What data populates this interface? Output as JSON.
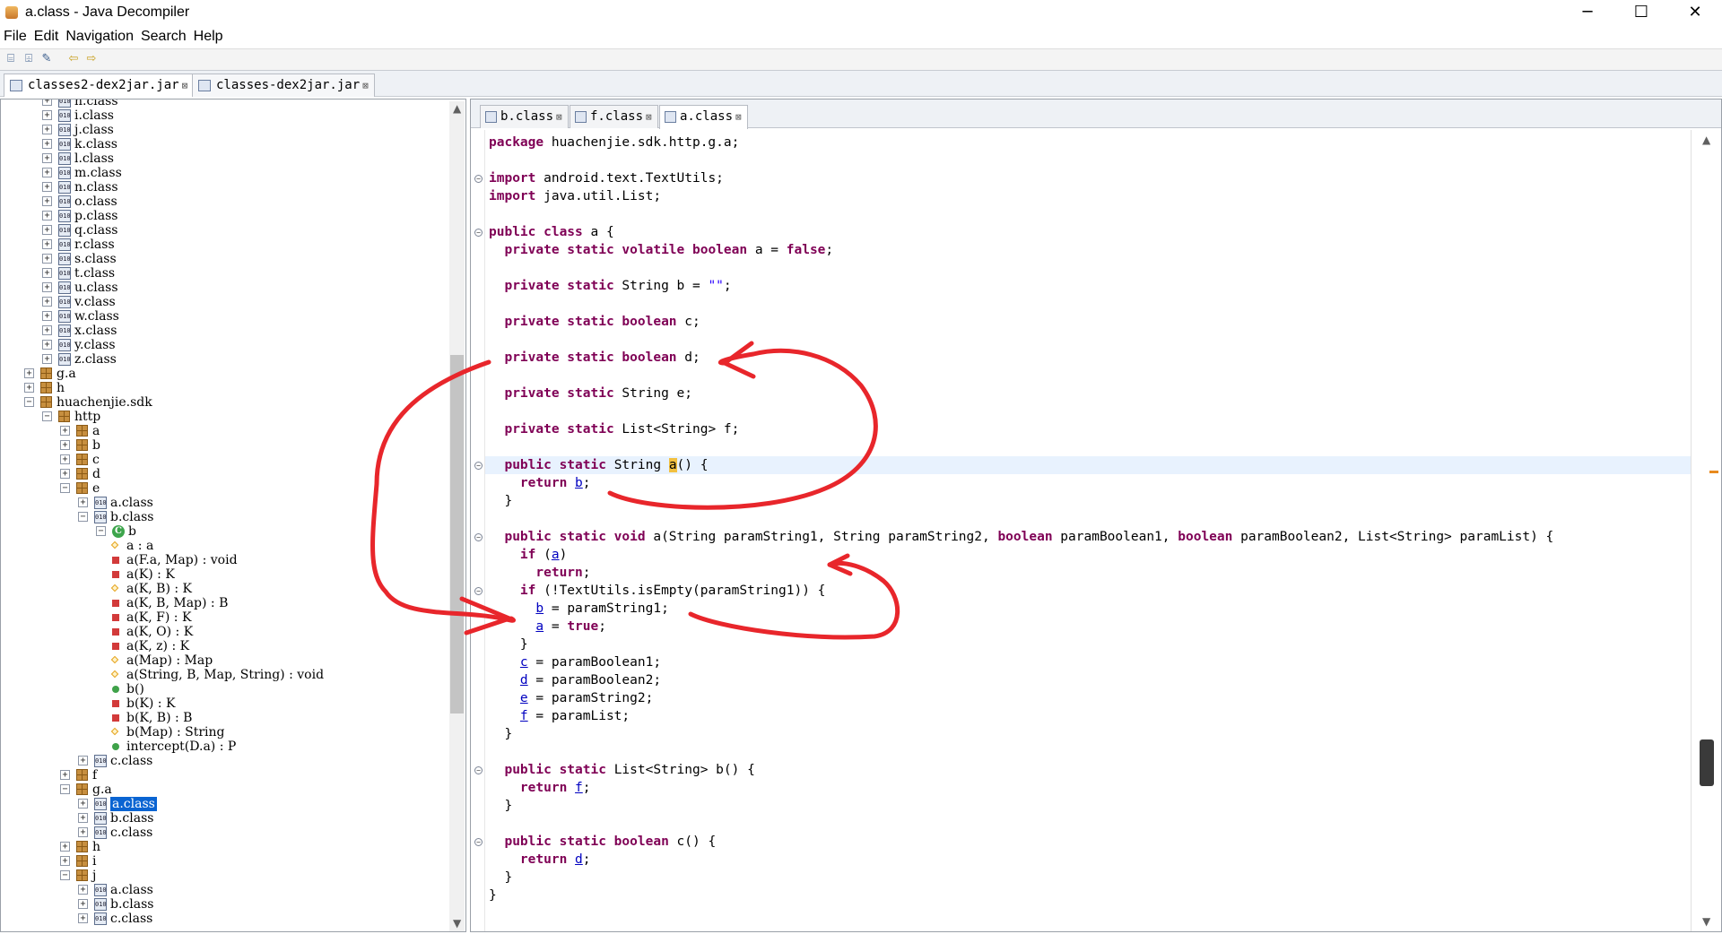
{
  "window": {
    "title": "a.class - Java Decompiler",
    "minimize": "─",
    "maximize": "☐",
    "close": "✕"
  },
  "menu": [
    "File",
    "Edit",
    "Navigation",
    "Search",
    "Help"
  ],
  "toolbar": {
    "icons": [
      "open-folder-icon",
      "open-file-icon",
      "pin-icon",
      "back-arrow-icon",
      "forward-arrow-icon"
    ],
    "glyphs": [
      "⌸",
      "⌹",
      "✎",
      "⇦",
      "⇨"
    ]
  },
  "jar_tabs": [
    {
      "label": "classes2-dex2jar.jar",
      "close": "⊠",
      "active": true
    },
    {
      "label": "classes-dex2jar.jar",
      "close": "⊠",
      "active": false
    }
  ],
  "tree": [
    {
      "depth": 2,
      "kind": "class",
      "label": "h.class",
      "exp": "+"
    },
    {
      "depth": 2,
      "kind": "class",
      "label": "i.class",
      "exp": "+"
    },
    {
      "depth": 2,
      "kind": "class",
      "label": "j.class",
      "exp": "+"
    },
    {
      "depth": 2,
      "kind": "class",
      "label": "k.class",
      "exp": "+"
    },
    {
      "depth": 2,
      "kind": "class",
      "label": "l.class",
      "exp": "+"
    },
    {
      "depth": 2,
      "kind": "class",
      "label": "m.class",
      "exp": "+"
    },
    {
      "depth": 2,
      "kind": "class",
      "label": "n.class",
      "exp": "+"
    },
    {
      "depth": 2,
      "kind": "class",
      "label": "o.class",
      "exp": "+"
    },
    {
      "depth": 2,
      "kind": "class",
      "label": "p.class",
      "exp": "+"
    },
    {
      "depth": 2,
      "kind": "class",
      "label": "q.class",
      "exp": "+"
    },
    {
      "depth": 2,
      "kind": "class",
      "label": "r.class",
      "exp": "+"
    },
    {
      "depth": 2,
      "kind": "class",
      "label": "s.class",
      "exp": "+"
    },
    {
      "depth": 2,
      "kind": "class",
      "label": "t.class",
      "exp": "+"
    },
    {
      "depth": 2,
      "kind": "class",
      "label": "u.class",
      "exp": "+"
    },
    {
      "depth": 2,
      "kind": "class",
      "label": "v.class",
      "exp": "+"
    },
    {
      "depth": 2,
      "kind": "class",
      "label": "w.class",
      "exp": "+"
    },
    {
      "depth": 2,
      "kind": "class",
      "label": "x.class",
      "exp": "+"
    },
    {
      "depth": 2,
      "kind": "class",
      "label": "y.class",
      "exp": "+"
    },
    {
      "depth": 2,
      "kind": "class",
      "label": "z.class",
      "exp": "+"
    },
    {
      "depth": 1,
      "kind": "pkg",
      "label": "g.a",
      "exp": "+"
    },
    {
      "depth": 1,
      "kind": "pkg",
      "label": "h",
      "exp": "+"
    },
    {
      "depth": 1,
      "kind": "pkg",
      "label": "huachenjie.sdk",
      "exp": "−"
    },
    {
      "depth": 2,
      "kind": "pkg",
      "label": "http",
      "exp": "−"
    },
    {
      "depth": 3,
      "kind": "pkg",
      "label": "a",
      "exp": "+"
    },
    {
      "depth": 3,
      "kind": "pkg",
      "label": "b",
      "exp": "+"
    },
    {
      "depth": 3,
      "kind": "pkg",
      "label": "c",
      "exp": "+"
    },
    {
      "depth": 3,
      "kind": "pkg",
      "label": "d",
      "exp": "+"
    },
    {
      "depth": 3,
      "kind": "pkg",
      "label": "e",
      "exp": "−"
    },
    {
      "depth": 4,
      "kind": "class",
      "label": "a.class",
      "exp": "+"
    },
    {
      "depth": 4,
      "kind": "class",
      "label": "b.class",
      "exp": "−"
    },
    {
      "depth": 5,
      "kind": "type",
      "label": "b",
      "exp": "−"
    },
    {
      "depth": 6,
      "kind": "dia",
      "label": "a : a",
      "exp": ""
    },
    {
      "depth": 6,
      "kind": "red",
      "label": "a(F.a, Map) : void",
      "exp": ""
    },
    {
      "depth": 6,
      "kind": "red",
      "label": "a(K) : K",
      "exp": ""
    },
    {
      "depth": 6,
      "kind": "dia",
      "label": "a(K, B) : K",
      "exp": ""
    },
    {
      "depth": 6,
      "kind": "red",
      "label": "a(K, B, Map) : B",
      "exp": ""
    },
    {
      "depth": 6,
      "kind": "red",
      "label": "a(K, F) : K",
      "exp": ""
    },
    {
      "depth": 6,
      "kind": "red",
      "label": "a(K, O) : K",
      "exp": ""
    },
    {
      "depth": 6,
      "kind": "red",
      "label": "a(K, z) : K",
      "exp": ""
    },
    {
      "depth": 6,
      "kind": "dia",
      "label": "a(Map) : Map",
      "exp": ""
    },
    {
      "depth": 6,
      "kind": "dia",
      "label": "a(String, B, Map, String) : void",
      "exp": ""
    },
    {
      "depth": 6,
      "kind": "green",
      "label": "b()",
      "exp": ""
    },
    {
      "depth": 6,
      "kind": "red",
      "label": "b(K) : K",
      "exp": ""
    },
    {
      "depth": 6,
      "kind": "red",
      "label": "b(K, B) : B",
      "exp": ""
    },
    {
      "depth": 6,
      "kind": "dia",
      "label": "b(Map) : String",
      "exp": ""
    },
    {
      "depth": 6,
      "kind": "green",
      "label": "intercept(D.a) : P",
      "exp": ""
    },
    {
      "depth": 4,
      "kind": "class",
      "label": "c.class",
      "exp": "+"
    },
    {
      "depth": 3,
      "kind": "pkg",
      "label": "f",
      "exp": "+"
    },
    {
      "depth": 3,
      "kind": "pkg",
      "label": "g.a",
      "exp": "−"
    },
    {
      "depth": 4,
      "kind": "class",
      "label": "a.class",
      "exp": "+",
      "selected": true
    },
    {
      "depth": 4,
      "kind": "class",
      "label": "b.class",
      "exp": "+"
    },
    {
      "depth": 4,
      "kind": "class",
      "label": "c.class",
      "exp": "+"
    },
    {
      "depth": 3,
      "kind": "pkg",
      "label": "h",
      "exp": "+"
    },
    {
      "depth": 3,
      "kind": "pkg",
      "label": "i",
      "exp": "+"
    },
    {
      "depth": 3,
      "kind": "pkg",
      "label": "j",
      "exp": "−"
    },
    {
      "depth": 4,
      "kind": "class",
      "label": "a.class",
      "exp": "+"
    },
    {
      "depth": 4,
      "kind": "class",
      "label": "b.class",
      "exp": "+"
    },
    {
      "depth": 4,
      "kind": "class",
      "label": "c.class",
      "exp": "+"
    }
  ],
  "editor_tabs": [
    {
      "label": "b.class",
      "close": "⊠",
      "active": false
    },
    {
      "label": "f.class",
      "close": "⊠",
      "active": false
    },
    {
      "label": "a.class",
      "close": "⊠",
      "active": true
    }
  ],
  "code": [
    {
      "line": 0,
      "fold": "",
      "html": "<span class='kw'>package</span> huachenjie.sdk.http.g.a;"
    },
    {
      "line": 2,
      "fold": "⊖",
      "html": "<span class='kw'>import</span> android.text.TextUtils;"
    },
    {
      "line": 3,
      "fold": "",
      "html": "<span class='kw'>import</span> java.util.List;"
    },
    {
      "line": 5,
      "fold": "⊖",
      "html": "<span class='kw'>public class</span> a {"
    },
    {
      "line": 6,
      "fold": "",
      "html": "  <span class='kw'>private static volatile boolean</span> a = <span class='kw'>false</span>;"
    },
    {
      "line": 8,
      "fold": "",
      "html": "  <span class='kw'>private static</span> String b = <span class='str'>\"\"</span>;"
    },
    {
      "line": 10,
      "fold": "",
      "html": "  <span class='kw'>private static boolean</span> c;"
    },
    {
      "line": 12,
      "fold": "",
      "html": "  <span class='kw'>private static boolean</span> d;"
    },
    {
      "line": 14,
      "fold": "",
      "html": "  <span class='kw'>private static</span> String e;"
    },
    {
      "line": 16,
      "fold": "",
      "html": "  <span class='kw'>private static</span> List&lt;String&gt; f;"
    },
    {
      "line": 18,
      "fold": "⊖",
      "html": "  <span class='kw'>public static</span> String <span class='hit'>a</span>() {",
      "hl": true
    },
    {
      "line": 19,
      "fold": "",
      "html": "    <span class='kw'>return</span> <span class='fld'>b</span>;"
    },
    {
      "line": 20,
      "fold": "",
      "html": "  }"
    },
    {
      "line": 22,
      "fold": "⊖",
      "html": "  <span class='kw'>public static void</span> a(String paramString1, String paramString2, <span class='kw'>boolean</span> paramBoolean1, <span class='kw'>boolean</span> paramBoolean2, List&lt;String&gt; paramList) {"
    },
    {
      "line": 23,
      "fold": "",
      "html": "    <span class='kw'>if</span> (<span class='fld'>a</span>)"
    },
    {
      "line": 24,
      "fold": "",
      "html": "      <span class='kw'>return</span>;"
    },
    {
      "line": 25,
      "fold": "⊖",
      "html": "    <span class='kw'>if</span> (!TextUtils.isEmpty(paramString1)) {"
    },
    {
      "line": 26,
      "fold": "",
      "html": "      <span class='fld'>b</span> = paramString1;"
    },
    {
      "line": 27,
      "fold": "",
      "html": "      <span class='fld'>a</span> = <span class='kw'>true</span>;"
    },
    {
      "line": 28,
      "fold": "",
      "html": "    }"
    },
    {
      "line": 29,
      "fold": "",
      "html": "    <span class='fld'>c</span> = paramBoolean1;"
    },
    {
      "line": 30,
      "fold": "",
      "html": "    <span class='fld'>d</span> = paramBoolean2;"
    },
    {
      "line": 31,
      "fold": "",
      "html": "    <span class='fld'>e</span> = paramString2;"
    },
    {
      "line": 32,
      "fold": "",
      "html": "    <span class='fld'>f</span> = paramList;"
    },
    {
      "line": 33,
      "fold": "",
      "html": "  }"
    },
    {
      "line": 35,
      "fold": "⊖",
      "html": "  <span class='kw'>public static</span> List&lt;String&gt; b() {"
    },
    {
      "line": 36,
      "fold": "",
      "html": "    <span class='kw'>return</span> <span class='fld'>f</span>;"
    },
    {
      "line": 37,
      "fold": "",
      "html": "  }"
    },
    {
      "line": 39,
      "fold": "⊖",
      "html": "  <span class='kw'>public static boolean</span> c() {"
    },
    {
      "line": 40,
      "fold": "",
      "html": "    <span class='kw'>return</span> <span class='fld'>d</span>;"
    },
    {
      "line": 41,
      "fold": "",
      "html": "  }"
    },
    {
      "line": 42,
      "fold": "",
      "html": "}"
    }
  ],
  "colors": {
    "annotation": "#e8262b",
    "keyword": "#7f0055",
    "string": "#2a00ff",
    "selection": "#0a64d2"
  }
}
